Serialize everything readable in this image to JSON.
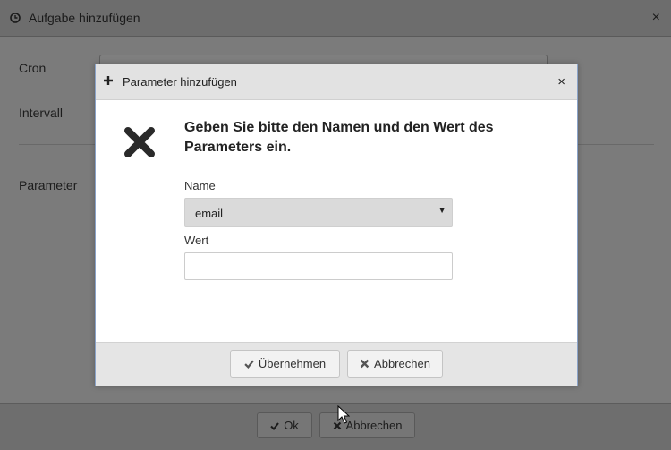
{
  "background_dialog": {
    "title": "Aufgabe hinzufügen",
    "title_icon": "clock-icon",
    "close_label": "×",
    "fields": {
      "cron_label": "Cron",
      "intervall_label": "Intervall",
      "parameter_label": "Parameter"
    },
    "footer": {
      "ok_label": "Ok",
      "cancel_label": "Abbrechen"
    }
  },
  "modal": {
    "title": "Parameter hinzufügen",
    "title_icon": "plus-icon",
    "close_label": "×",
    "icon": "error-x-icon",
    "message": "Geben Sie bitte den Namen und den Wert des Parameters ein.",
    "name_label": "Name",
    "name_value": "email",
    "wert_label": "Wert",
    "wert_value": "",
    "footer": {
      "apply_label": "Übernehmen",
      "cancel_label": "Abbrechen"
    }
  },
  "colors": {
    "modal_border": "#8aa3c9",
    "overlay_grey": "#7a7a7a"
  }
}
